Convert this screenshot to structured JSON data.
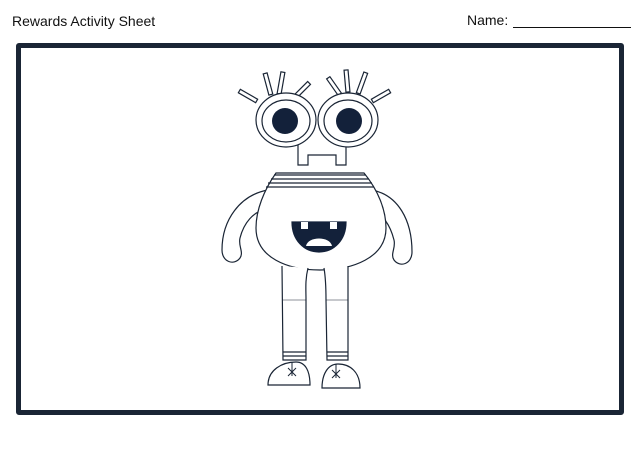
{
  "header": {
    "title": "Rewards Activity Sheet",
    "name_label": "Name:"
  },
  "colors": {
    "frame": "#1a2535",
    "outline": "#1a2535",
    "pupil": "#13213a"
  },
  "illustration": {
    "subject": "monster-coloring-outline"
  }
}
